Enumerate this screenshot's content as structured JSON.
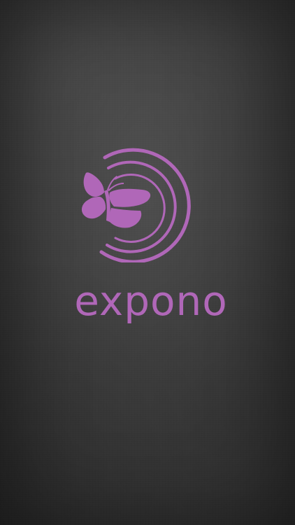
{
  "splash": {
    "brand_name": "expono",
    "logo_icon": "butterfly-icon",
    "brand_color": "#b067b8",
    "background_color": "#3e3e3e"
  }
}
